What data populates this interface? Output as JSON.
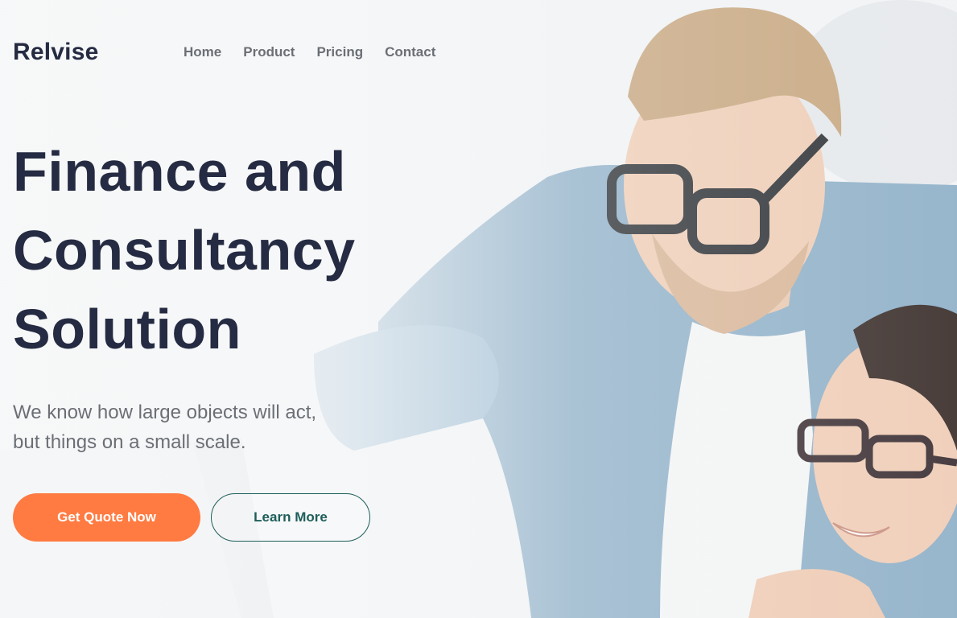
{
  "brand": {
    "name": "Relvise"
  },
  "nav": {
    "items": [
      {
        "label": "Home"
      },
      {
        "label": "Product"
      },
      {
        "label": "Pricing"
      },
      {
        "label": "Contact"
      }
    ]
  },
  "hero": {
    "headline_lines": [
      "Finance and",
      "Consultancy",
      "Solution"
    ],
    "subtitle_lines": [
      "We know how large objects will act,",
      "but things on a small scale."
    ],
    "primary_button": "Get Quote Now",
    "secondary_button": "Learn More"
  },
  "colors": {
    "heading": "#252b42",
    "muted_text": "#6b6f75",
    "accent_orange": "#ff7b42",
    "accent_teal": "#1e5e5a"
  },
  "image": {
    "description_icon": "hero-photo-image"
  }
}
